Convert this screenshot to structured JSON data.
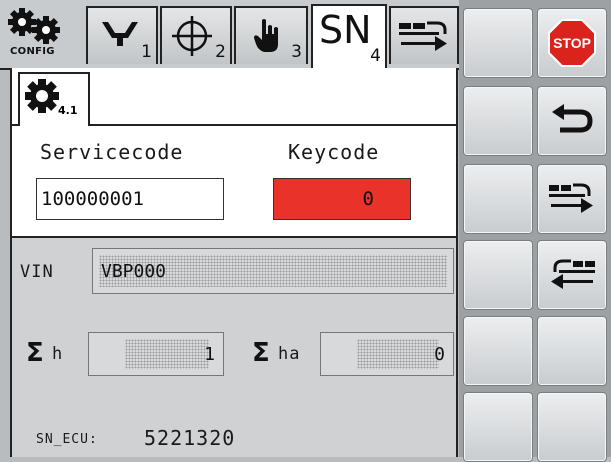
{
  "tabs": [
    {
      "icon": "config-gears-icon",
      "label": "CONFIG"
    },
    {
      "icon": "funnel-icon",
      "sub": "1"
    },
    {
      "icon": "crosshair-icon",
      "sub": "2"
    },
    {
      "icon": "hand-icon",
      "sub": "3"
    },
    {
      "label": "SN",
      "sub": "4",
      "active": true
    },
    {
      "icon": "machine-arrow-right-icon"
    }
  ],
  "subtab": {
    "icon": "gear-icon",
    "sub": "4.1"
  },
  "servicecode": {
    "label": "Servicecode",
    "value": "100000001"
  },
  "keycode": {
    "label": "Keycode",
    "value": "0",
    "color": "#e8322a"
  },
  "vin": {
    "label": "VIN",
    "value": "VBP000"
  },
  "sum_h": {
    "symbol": "Σ",
    "label": "h",
    "value": "1"
  },
  "sum_ha": {
    "symbol": "Σ",
    "label": "ha",
    "value": "0"
  },
  "sn_ecu": {
    "label": "SN_ECU:",
    "value": "5221320"
  },
  "softkeys": {
    "stop": {
      "label": "STOP",
      "color": "#d9231c"
    },
    "back": {
      "icon": "return-arrow-icon"
    },
    "export": {
      "icon": "machine-arrow-right-icon"
    },
    "import": {
      "icon": "machine-arrow-left-icon"
    }
  }
}
